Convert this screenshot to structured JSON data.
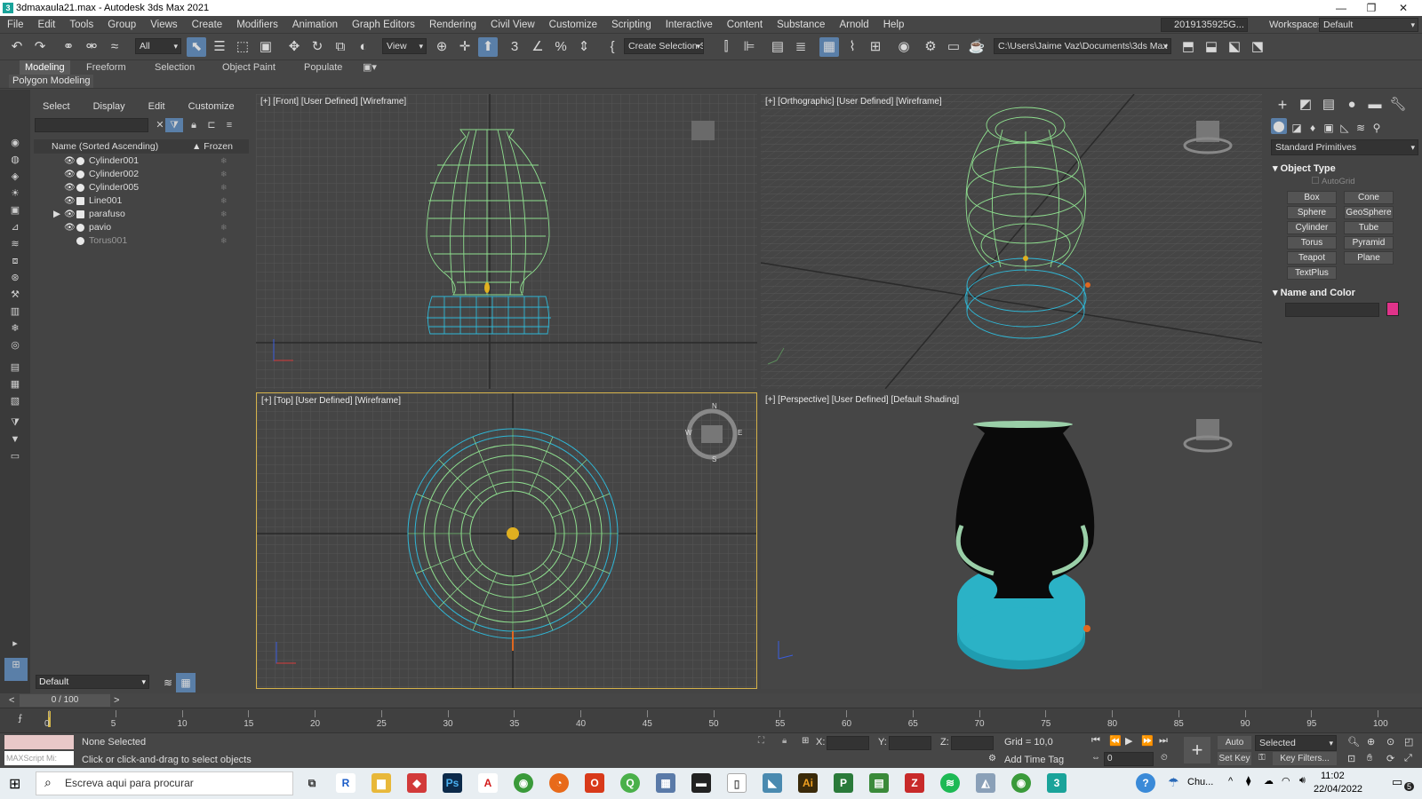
{
  "title": "3dmaxaula21.max - Autodesk 3ds Max 2021",
  "menu": [
    "File",
    "Edit",
    "Tools",
    "Group",
    "Views",
    "Create",
    "Modifiers",
    "Animation",
    "Graph Editors",
    "Rendering",
    "Civil View",
    "Customize",
    "Scripting",
    "Interactive",
    "Content",
    "Substance",
    "Arnold",
    "Help"
  ],
  "user": "2019135925G...",
  "workspaces_label": "Workspaces:",
  "workspace": "Default",
  "toolbar": {
    "filter": "All",
    "ref_coord": "View",
    "selection_set": "Create Selection Se",
    "project_path": "C:\\Users\\Jaime Vaz\\Documents\\3ds Max 2021"
  },
  "ribbon_tabs": [
    "Modeling",
    "Freeform",
    "Selection",
    "Object Paint",
    "Populate"
  ],
  "ribbon_sub": "Polygon Modeling",
  "explorer": {
    "tabs": [
      "Select",
      "Display",
      "Edit",
      "Customize"
    ],
    "col_name": "Name (Sorted Ascending)",
    "col_frozen": "▲ Frozen",
    "items": [
      "Cylinder001",
      "Cylinder002",
      "Cylinder005",
      "Line001",
      "parafuso",
      "pavio",
      "Torus001"
    ],
    "layer": "Default"
  },
  "viewports": {
    "front": "[+] [Front] [User Defined] [Wireframe]",
    "ortho": "[+] [Orthographic] [User Defined] [Wireframe]",
    "top": "[+] [Top] [User Defined] [Wireframe]",
    "persp": "[+] [Perspective] [User Defined] [Default Shading]"
  },
  "compass": {
    "n": "N",
    "s": "S",
    "e": "E",
    "w": "W"
  },
  "cmdpanel": {
    "category": "Standard Primitives",
    "object_type": "Object Type",
    "autogrid": "AutoGrid",
    "buttons": [
      "Box",
      "Cone",
      "Sphere",
      "GeoSphere",
      "Cylinder",
      "Tube",
      "Torus",
      "Pyramid",
      "Teapot",
      "Plane",
      "TextPlus"
    ],
    "name_color": "Name and Color",
    "swatch": "#e0338a"
  },
  "timeline": {
    "frame": "0 / 100",
    "ticks": [
      "0",
      "5",
      "10",
      "15",
      "20",
      "25",
      "30",
      "35",
      "40",
      "45",
      "50",
      "55",
      "60",
      "65",
      "70",
      "75",
      "80",
      "85",
      "90",
      "95",
      "100"
    ]
  },
  "status": {
    "script": "MAXScript Mi:",
    "selected": "None Selected",
    "hint": "Click or click-and-drag to select objects",
    "x": "X:",
    "y": "Y:",
    "z": "Z:",
    "grid": "Grid = 10,0",
    "add_time_tag": "Add Time Tag",
    "auto_key": "Auto Key",
    "set_key": "Set Key",
    "key_mode": "Selected",
    "key_filters": "Key Filters...",
    "frame_val": "0"
  },
  "taskbar": {
    "search": "Escreva aqui para procurar",
    "weather": "Chu...",
    "time": "11:02",
    "date": "22/04/2022",
    "notif": "5"
  },
  "colors": {
    "green_wire": "#8fe08f",
    "cyan_wire": "#2fb7d6",
    "lamp_base": "#2bb2c6",
    "lamp_glass": "#0a0a0a",
    "viewport_bg": "#454545",
    "active_border": "#d5b24a"
  }
}
